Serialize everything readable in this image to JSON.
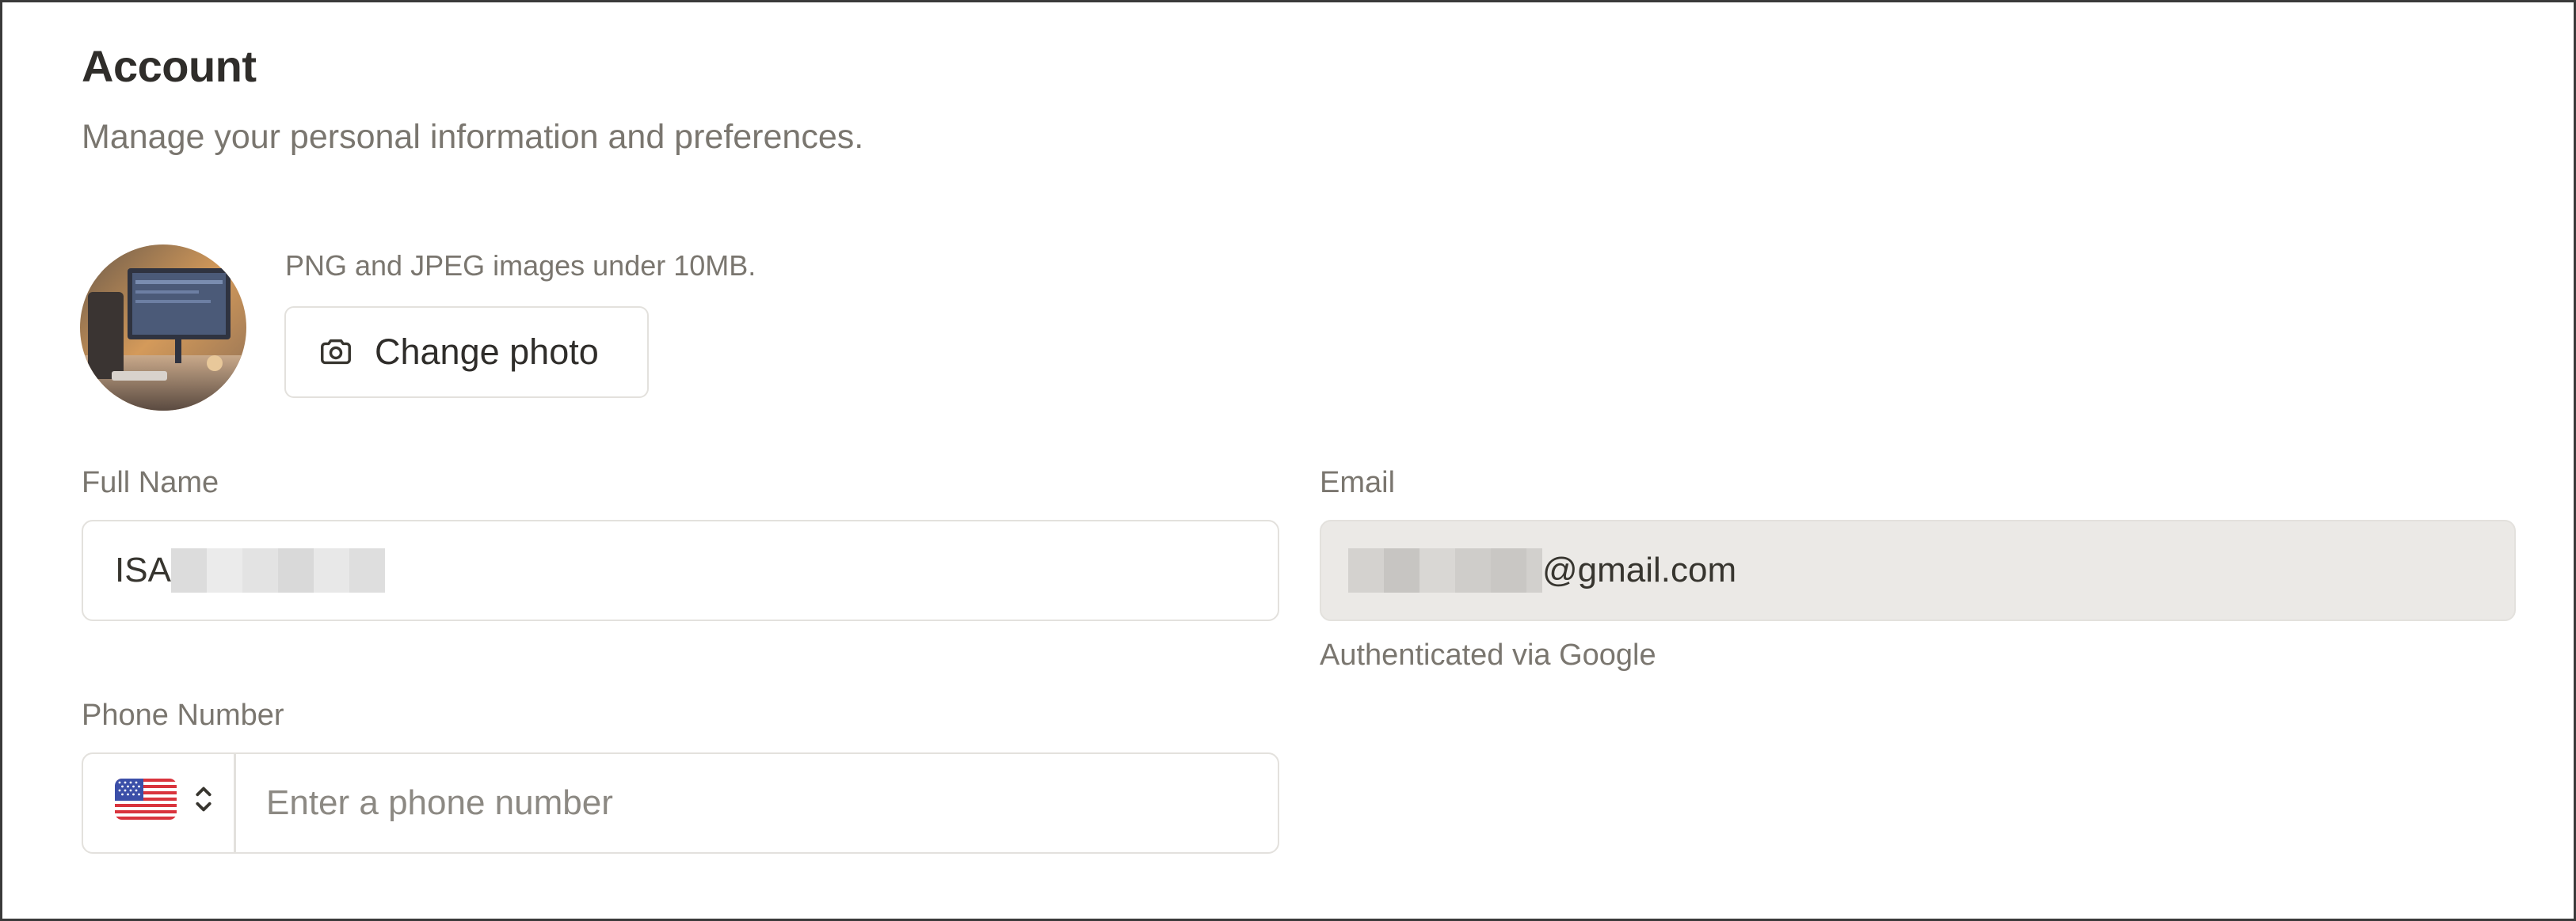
{
  "header": {
    "title": "Account",
    "subtitle": "Manage your personal information and preferences."
  },
  "photo": {
    "hint": "PNG and JPEG images under 10MB.",
    "change_label": "Change photo",
    "icon": "camera-icon"
  },
  "form": {
    "full_name": {
      "label": "Full Name",
      "value_visible": "ISA"
    },
    "email": {
      "label": "Email",
      "value_suffix": "@gmail.com",
      "note": "Authenticated via Google"
    },
    "phone": {
      "label": "Phone Number",
      "placeholder": "Enter a phone number",
      "country_flag": "us-flag-icon",
      "country_selector_icon": "chevron-up-down-icon"
    }
  }
}
